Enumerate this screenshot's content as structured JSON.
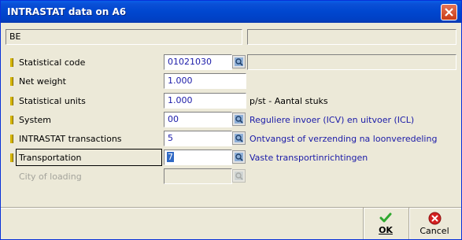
{
  "window": {
    "title": "INTRASTAT data on A6"
  },
  "header": {
    "country_value": "BE",
    "secondary_value": ""
  },
  "fields": {
    "statistical_code": {
      "label": "Statistical code",
      "value": "01021030",
      "description": ""
    },
    "net_weight": {
      "label": "Net weight",
      "value": "1.000"
    },
    "statistical_units": {
      "label": "Statistical units",
      "value": "1.000",
      "description": "p/st - Aantal stuks"
    },
    "system": {
      "label": "System",
      "value": "00",
      "description": "Reguliere invoer (ICV) en uitvoer (ICL)"
    },
    "intrastat_transactions": {
      "label": "INTRASTAT transactions",
      "value": "5",
      "description": "Ontvangst of verzending na loonveredeling"
    },
    "transportation": {
      "label": "Transportation",
      "value": "7",
      "description": "Vaste transportinrichtingen"
    },
    "city_of_loading": {
      "label": "City of loading",
      "value": ""
    }
  },
  "buttons": {
    "ok_label": "OK",
    "cancel_label": "Cancel"
  },
  "colors": {
    "titlebar": "#0047cf",
    "value_text": "#1a1aa8",
    "required_marker": "#d4b400",
    "ok_icon": "#2fa82f",
    "cancel_icon": "#d42020"
  }
}
